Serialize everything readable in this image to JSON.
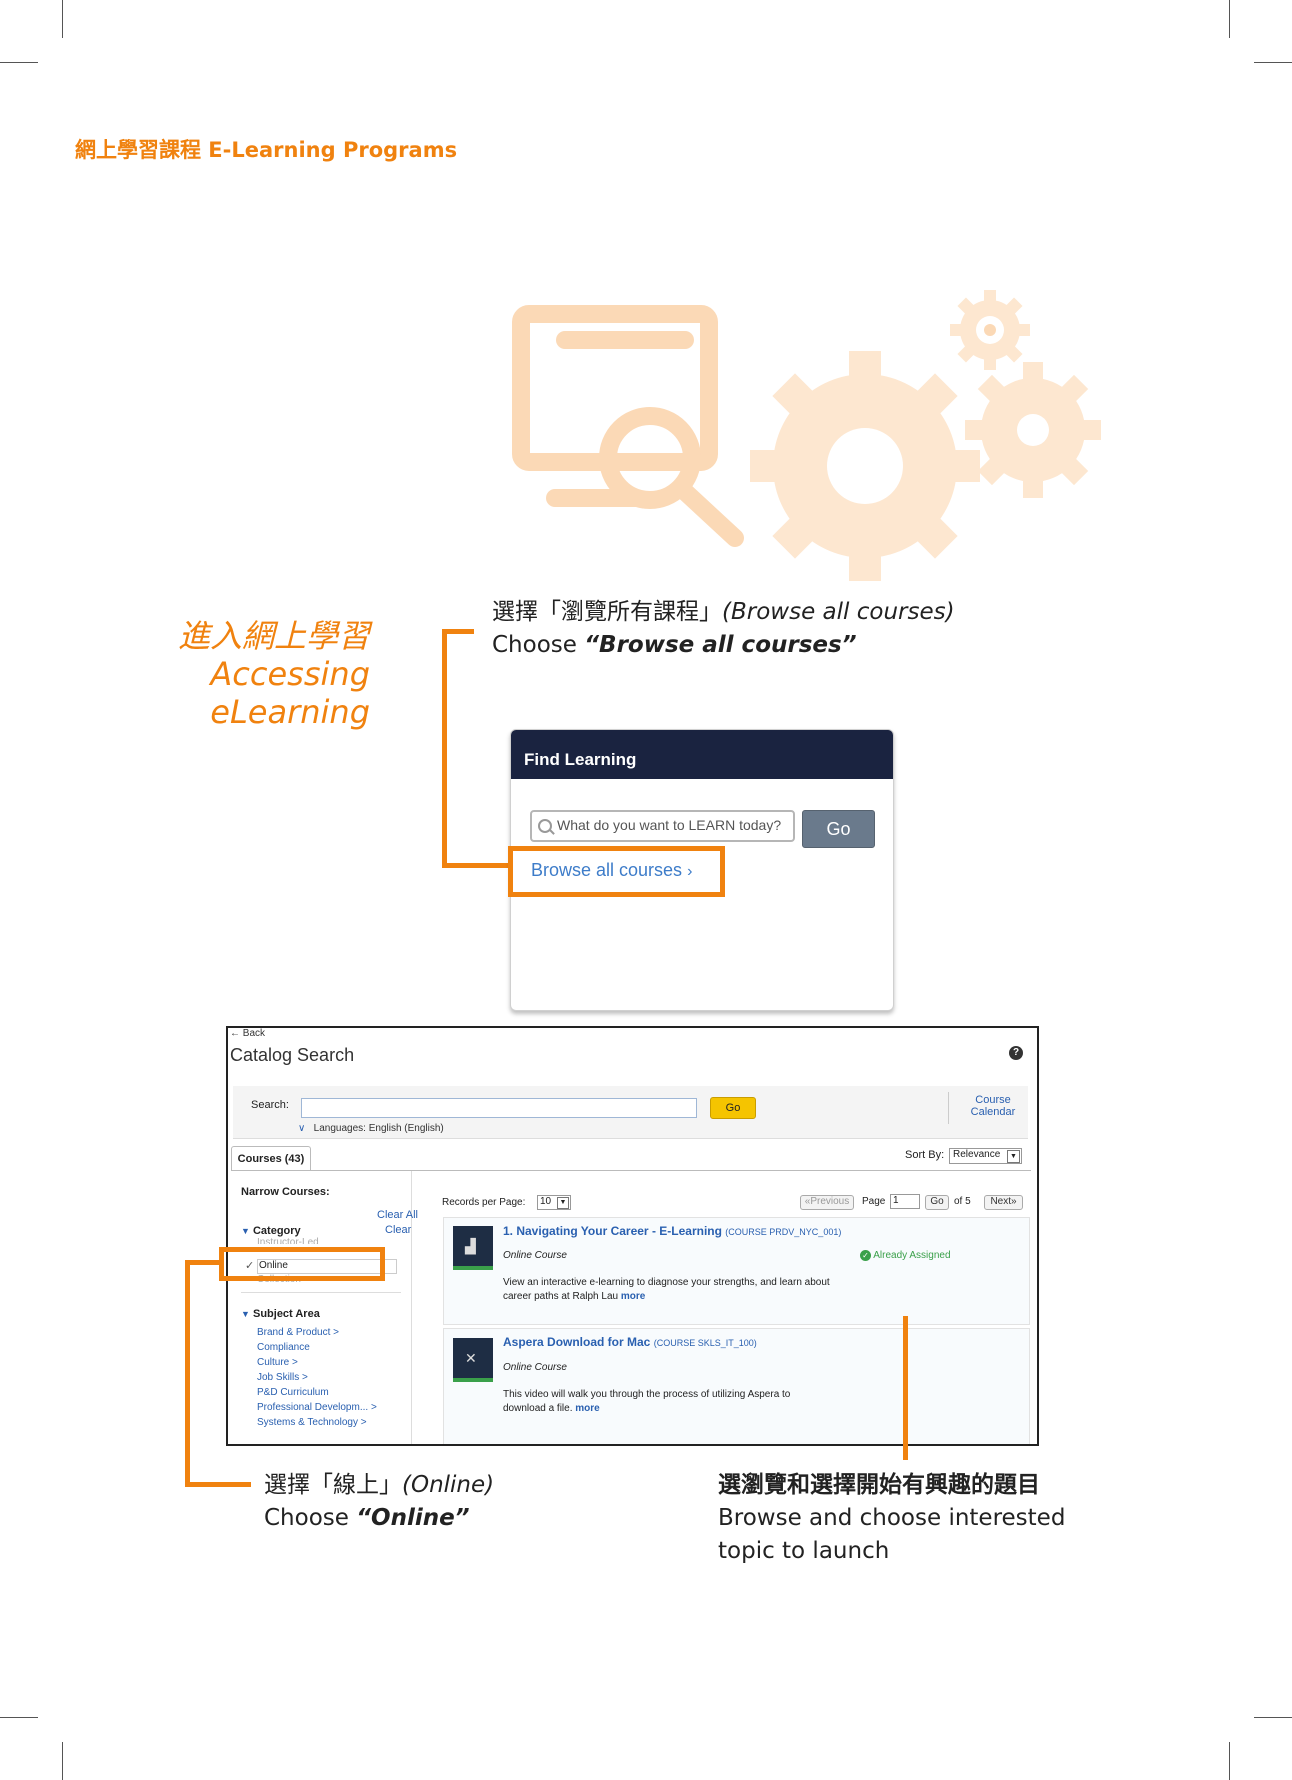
{
  "header": {
    "title": "網上學習課程 E-Learning Programs"
  },
  "side_title": {
    "line1": "進入網上學習",
    "line2": "Accessing",
    "line3": "eLearning"
  },
  "step1": {
    "zh": "選擇「瀏覽所有課程」",
    "zh_en": "(Browse all courses)",
    "choose": "Choose ",
    "bold": "“Browse all courses”"
  },
  "find_learning": {
    "title": "Find Learning",
    "search_placeholder": "What do you want to LEARN today?",
    "go": "Go",
    "browse": "Browse all courses"
  },
  "catalog": {
    "back": "← Back",
    "title": "Catalog Search",
    "help": "?",
    "search_label": "Search:",
    "go": "Go",
    "course_calendar_1": "Course",
    "course_calendar_2": "Calendar",
    "languages": "Languages: English (English)",
    "tab": "Courses (43)",
    "sort_by": "Sort By:",
    "sort_value": "Relevance",
    "narrow": "Narrow Courses:",
    "clear_all": "Clear All",
    "category": "Category",
    "clear": "Clear",
    "cat_above": "Instructor-Led",
    "cat_online": "Online",
    "cat_below": "Collection",
    "subject_area": "Subject Area",
    "subjects": [
      "Brand & Product",
      "Compliance",
      "Culture",
      "Job Skills",
      "P&D Curriculum",
      "Professional Developm...",
      "Systems & Technology"
    ],
    "records_label": "Records per Page:",
    "records_value": "10",
    "previous": "«Previous",
    "page_label": "Page",
    "page_value": "1",
    "page_go": "Go",
    "of": "of 5",
    "next": "Next»",
    "courses": [
      {
        "title": "1. Navigating Your Career - E-Learning",
        "code": "(COURSE PRDV_NYC_001)",
        "type": "Online Course",
        "status": "Already Assigned",
        "desc1": "View an interactive e-learning to diagnose your strengths, and learn about",
        "desc2": "career paths at Ralph Lau",
        "more": "more"
      },
      {
        "title": "Aspera Download for Mac",
        "code": "(COURSE SKLS_IT_100)",
        "type": "Online Course",
        "desc1": "This video will walk you through the process of utilizing Aspera to",
        "desc2": "download a file.",
        "more": "more"
      }
    ]
  },
  "step2": {
    "zh": "選擇「線上」",
    "zh_en": "(Online)",
    "choose": "Choose ",
    "bold": "“Online”"
  },
  "step3": {
    "zh": "選瀏覽和選擇開始有興趣的題目",
    "line1": "Browse and choose interested",
    "line2": "topic to launch"
  },
  "colors": {
    "accent": "#f0820f",
    "navy": "#1a2340",
    "link": "#3d7cc9"
  }
}
